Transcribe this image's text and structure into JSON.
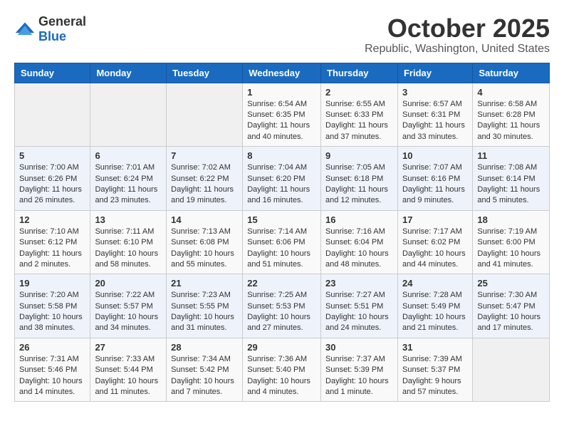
{
  "logo": {
    "general": "General",
    "blue": "Blue"
  },
  "header": {
    "month": "October 2025",
    "location": "Republic, Washington, United States"
  },
  "weekdays": [
    "Sunday",
    "Monday",
    "Tuesday",
    "Wednesday",
    "Thursday",
    "Friday",
    "Saturday"
  ],
  "weeks": [
    [
      {
        "day": "",
        "sunrise": "",
        "sunset": "",
        "daylight": ""
      },
      {
        "day": "",
        "sunrise": "",
        "sunset": "",
        "daylight": ""
      },
      {
        "day": "",
        "sunrise": "",
        "sunset": "",
        "daylight": ""
      },
      {
        "day": "1",
        "sunrise": "Sunrise: 6:54 AM",
        "sunset": "Sunset: 6:35 PM",
        "daylight": "Daylight: 11 hours and 40 minutes."
      },
      {
        "day": "2",
        "sunrise": "Sunrise: 6:55 AM",
        "sunset": "Sunset: 6:33 PM",
        "daylight": "Daylight: 11 hours and 37 minutes."
      },
      {
        "day": "3",
        "sunrise": "Sunrise: 6:57 AM",
        "sunset": "Sunset: 6:31 PM",
        "daylight": "Daylight: 11 hours and 33 minutes."
      },
      {
        "day": "4",
        "sunrise": "Sunrise: 6:58 AM",
        "sunset": "Sunset: 6:28 PM",
        "daylight": "Daylight: 11 hours and 30 minutes."
      }
    ],
    [
      {
        "day": "5",
        "sunrise": "Sunrise: 7:00 AM",
        "sunset": "Sunset: 6:26 PM",
        "daylight": "Daylight: 11 hours and 26 minutes."
      },
      {
        "day": "6",
        "sunrise": "Sunrise: 7:01 AM",
        "sunset": "Sunset: 6:24 PM",
        "daylight": "Daylight: 11 hours and 23 minutes."
      },
      {
        "day": "7",
        "sunrise": "Sunrise: 7:02 AM",
        "sunset": "Sunset: 6:22 PM",
        "daylight": "Daylight: 11 hours and 19 minutes."
      },
      {
        "day": "8",
        "sunrise": "Sunrise: 7:04 AM",
        "sunset": "Sunset: 6:20 PM",
        "daylight": "Daylight: 11 hours and 16 minutes."
      },
      {
        "day": "9",
        "sunrise": "Sunrise: 7:05 AM",
        "sunset": "Sunset: 6:18 PM",
        "daylight": "Daylight: 11 hours and 12 minutes."
      },
      {
        "day": "10",
        "sunrise": "Sunrise: 7:07 AM",
        "sunset": "Sunset: 6:16 PM",
        "daylight": "Daylight: 11 hours and 9 minutes."
      },
      {
        "day": "11",
        "sunrise": "Sunrise: 7:08 AM",
        "sunset": "Sunset: 6:14 PM",
        "daylight": "Daylight: 11 hours and 5 minutes."
      }
    ],
    [
      {
        "day": "12",
        "sunrise": "Sunrise: 7:10 AM",
        "sunset": "Sunset: 6:12 PM",
        "daylight": "Daylight: 11 hours and 2 minutes."
      },
      {
        "day": "13",
        "sunrise": "Sunrise: 7:11 AM",
        "sunset": "Sunset: 6:10 PM",
        "daylight": "Daylight: 10 hours and 58 minutes."
      },
      {
        "day": "14",
        "sunrise": "Sunrise: 7:13 AM",
        "sunset": "Sunset: 6:08 PM",
        "daylight": "Daylight: 10 hours and 55 minutes."
      },
      {
        "day": "15",
        "sunrise": "Sunrise: 7:14 AM",
        "sunset": "Sunset: 6:06 PM",
        "daylight": "Daylight: 10 hours and 51 minutes."
      },
      {
        "day": "16",
        "sunrise": "Sunrise: 7:16 AM",
        "sunset": "Sunset: 6:04 PM",
        "daylight": "Daylight: 10 hours and 48 minutes."
      },
      {
        "day": "17",
        "sunrise": "Sunrise: 7:17 AM",
        "sunset": "Sunset: 6:02 PM",
        "daylight": "Daylight: 10 hours and 44 minutes."
      },
      {
        "day": "18",
        "sunrise": "Sunrise: 7:19 AM",
        "sunset": "Sunset: 6:00 PM",
        "daylight": "Daylight: 10 hours and 41 minutes."
      }
    ],
    [
      {
        "day": "19",
        "sunrise": "Sunrise: 7:20 AM",
        "sunset": "Sunset: 5:58 PM",
        "daylight": "Daylight: 10 hours and 38 minutes."
      },
      {
        "day": "20",
        "sunrise": "Sunrise: 7:22 AM",
        "sunset": "Sunset: 5:57 PM",
        "daylight": "Daylight: 10 hours and 34 minutes."
      },
      {
        "day": "21",
        "sunrise": "Sunrise: 7:23 AM",
        "sunset": "Sunset: 5:55 PM",
        "daylight": "Daylight: 10 hours and 31 minutes."
      },
      {
        "day": "22",
        "sunrise": "Sunrise: 7:25 AM",
        "sunset": "Sunset: 5:53 PM",
        "daylight": "Daylight: 10 hours and 27 minutes."
      },
      {
        "day": "23",
        "sunrise": "Sunrise: 7:27 AM",
        "sunset": "Sunset: 5:51 PM",
        "daylight": "Daylight: 10 hours and 24 minutes."
      },
      {
        "day": "24",
        "sunrise": "Sunrise: 7:28 AM",
        "sunset": "Sunset: 5:49 PM",
        "daylight": "Daylight: 10 hours and 21 minutes."
      },
      {
        "day": "25",
        "sunrise": "Sunrise: 7:30 AM",
        "sunset": "Sunset: 5:47 PM",
        "daylight": "Daylight: 10 hours and 17 minutes."
      }
    ],
    [
      {
        "day": "26",
        "sunrise": "Sunrise: 7:31 AM",
        "sunset": "Sunset: 5:46 PM",
        "daylight": "Daylight: 10 hours and 14 minutes."
      },
      {
        "day": "27",
        "sunrise": "Sunrise: 7:33 AM",
        "sunset": "Sunset: 5:44 PM",
        "daylight": "Daylight: 10 hours and 11 minutes."
      },
      {
        "day": "28",
        "sunrise": "Sunrise: 7:34 AM",
        "sunset": "Sunset: 5:42 PM",
        "daylight": "Daylight: 10 hours and 7 minutes."
      },
      {
        "day": "29",
        "sunrise": "Sunrise: 7:36 AM",
        "sunset": "Sunset: 5:40 PM",
        "daylight": "Daylight: 10 hours and 4 minutes."
      },
      {
        "day": "30",
        "sunrise": "Sunrise: 7:37 AM",
        "sunset": "Sunset: 5:39 PM",
        "daylight": "Daylight: 10 hours and 1 minute."
      },
      {
        "day": "31",
        "sunrise": "Sunrise: 7:39 AM",
        "sunset": "Sunset: 5:37 PM",
        "daylight": "Daylight: 9 hours and 57 minutes."
      },
      {
        "day": "",
        "sunrise": "",
        "sunset": "",
        "daylight": ""
      }
    ]
  ]
}
